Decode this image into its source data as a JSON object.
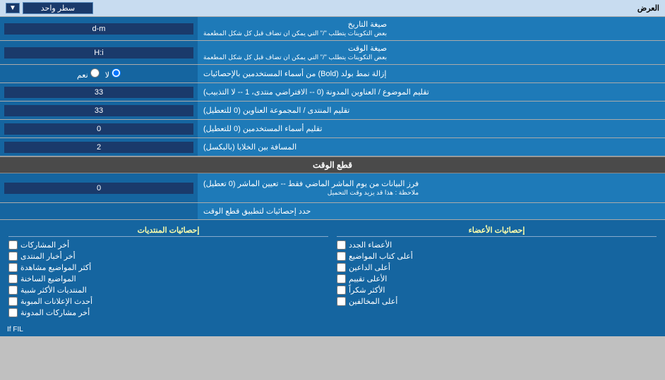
{
  "topBar": {
    "label": "العرض",
    "dropdown_label": "سطر واحد",
    "dropdown_arrow": "▼"
  },
  "rows": [
    {
      "id": "date-format",
      "label": "صيغة التاريخ\nبعض التكوينات يتطلب \"/\" التي يمكن ان تضاف قبل كل شكل المطعمة",
      "value": "d-m",
      "type": "text"
    },
    {
      "id": "time-format",
      "label": "صيغة الوقت\nبعض التكوينات يتطلب \"/\" التي يمكن ان تضاف قبل كل شكل المطعمة",
      "value": "H:i",
      "type": "text"
    },
    {
      "id": "bold-remove",
      "label": "إزالة نمط بولد (Bold) من أسماء المستخدمين بالإحصائيات",
      "value_yes": "نعم",
      "value_no": "لا",
      "type": "radio",
      "selected": "no"
    },
    {
      "id": "topic-address",
      "label": "تقليم الموضوع / العناوين المدونة (0 -- الافتراضي منتدى، 1 -- لا التذبيب)",
      "value": "33",
      "type": "text"
    },
    {
      "id": "forum-group",
      "label": "تقليم المنتدى / المجموعة العناوين (0 للتعطيل)",
      "value": "33",
      "type": "text"
    },
    {
      "id": "trim-usernames",
      "label": "تقليم أسماء المستخدمين (0 للتعطيل)",
      "value": "0",
      "type": "text"
    },
    {
      "id": "cell-spacing",
      "label": "المسافة بين الخلايا (بالبكسل)",
      "value": "2",
      "type": "text"
    }
  ],
  "cutSection": {
    "header": "قطع الوقت",
    "cutRow": {
      "label": "فرز البيانات من يوم الماشر الماضي فقط -- تعيين الماشر (0 تعطيل)\nملاحظة : هذا قد يزيد وقت التحميل",
      "value": "0"
    },
    "statsLabel": "حدد إحصائيات لتطبيق قطع الوقت"
  },
  "statsColumns": {
    "col1Header": "إحصائيات الأعضاء",
    "col2Header": "إحصائيات المنتديات",
    "col1Items": [
      "الأعضاء الجدد",
      "أعلى كتاب المواضيع",
      "أعلى الداعين",
      "الأعلى تقييم",
      "الأكثر شكراً",
      "أعلى المخالفين"
    ],
    "col2Items": [
      "أخر المشاركات",
      "أخر أخبار المنتدى",
      "أكثر المواضيع مشاهدة",
      "المواضيع الساخنة",
      "المنتديات الأكثر شبية",
      "أحدث الإعلانات المبوبة",
      "أخر مشاركات المدونة"
    ]
  },
  "ifFil": "If FIL"
}
